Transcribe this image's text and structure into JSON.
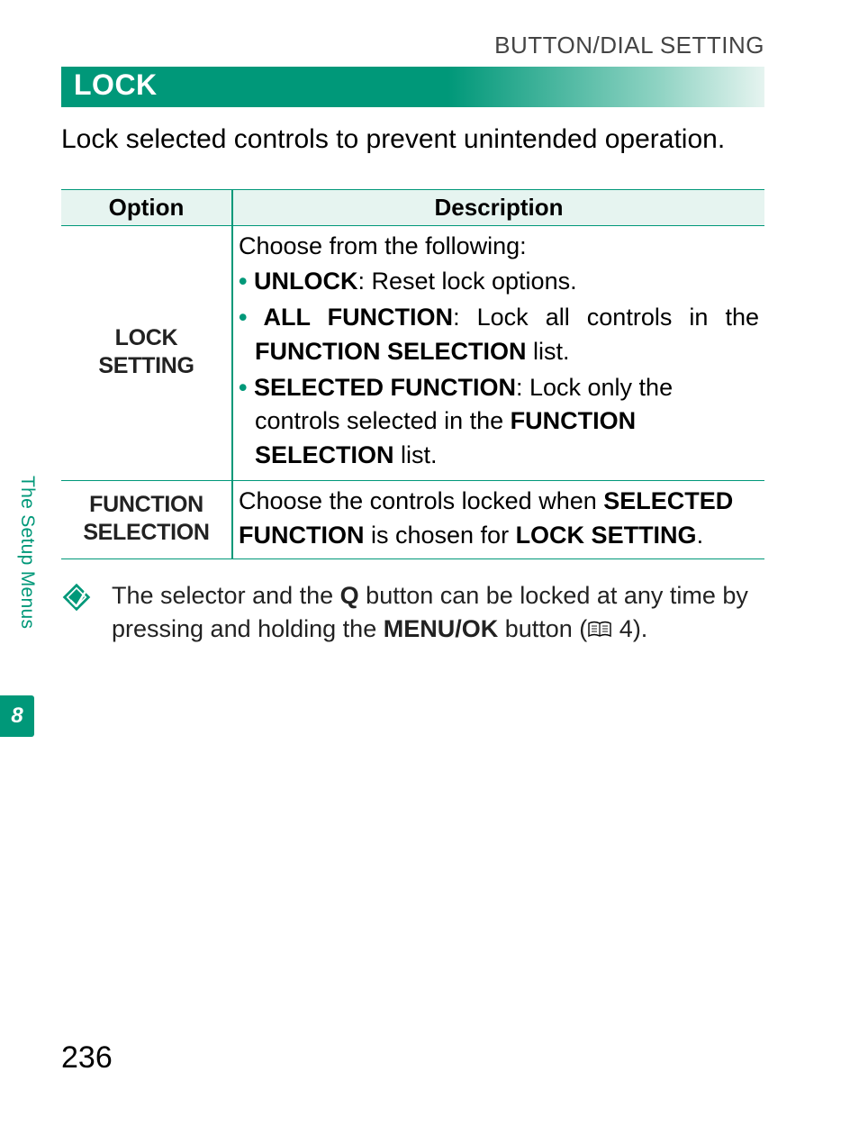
{
  "breadcrumb": "BUTTON/DIAL SETTING",
  "section_title": "LOCK",
  "intro": "Lock selected controls to prevent unintended operation.",
  "table": {
    "headers": {
      "option": "Option",
      "description": "Description"
    },
    "rows": [
      {
        "option": "LOCK SETTING",
        "lead": "Choose from the following:",
        "items": [
          {
            "name": "UNLOCK",
            "text": ": Reset lock options."
          },
          {
            "name": "ALL FUNCTION",
            "text_before": ": Lock all controls in the ",
            "bold_mid": "FUNCTION SELECTION",
            "text_after": " list."
          },
          {
            "name": "SELECTED FUNCTION",
            "text_before": ": Lock only the controls selected in the ",
            "bold_mid": "FUNCTION SELECTION",
            "text_after": " list."
          }
        ]
      },
      {
        "option": "FUNCTION SELECTION",
        "desc_plain_before": "Choose the controls locked when ",
        "desc_bold1": "SELECTED FUNCTION",
        "desc_mid": " is chosen for ",
        "desc_bold2": "LOCK SETTING",
        "desc_after": "."
      }
    ]
  },
  "note": {
    "before": "The selector and the ",
    "q": "Q",
    "mid1": " button can be locked at any time by pressing and holding the ",
    "menuok": "MENU/OK",
    "mid2": " button (",
    "page_ref": " 4).",
    "page_ref_num": "4"
  },
  "side": {
    "label": "The Setup Menus",
    "chapter": "8"
  },
  "page_number": "236"
}
